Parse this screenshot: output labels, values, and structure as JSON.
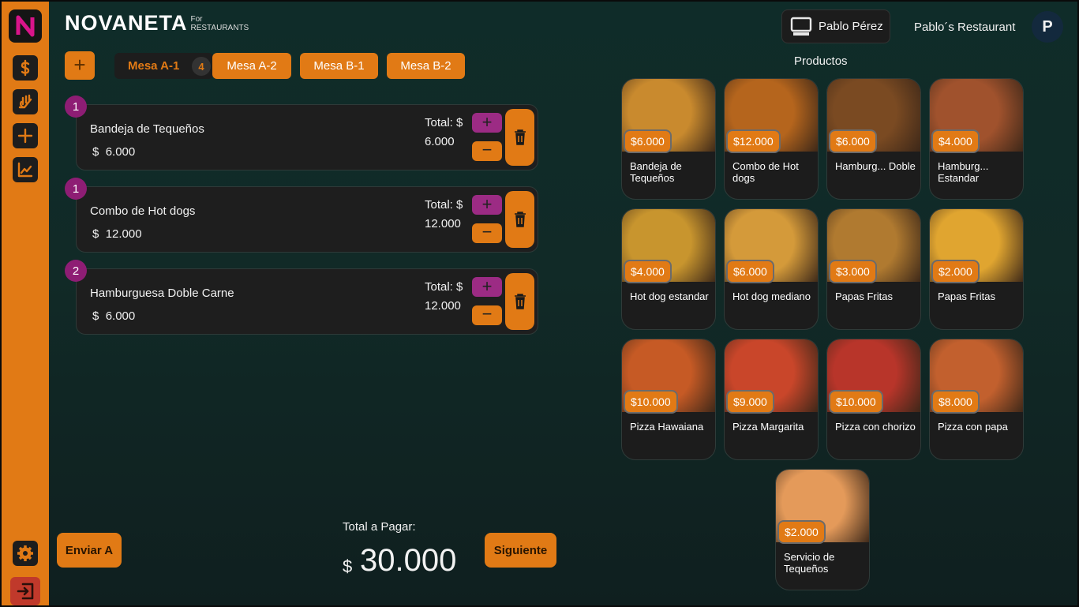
{
  "header": {
    "brand": "NOVANETA",
    "brand_for": "For",
    "brand_sub": "RESTAURANTS",
    "user_name": "Pablo Pérez",
    "restaurant": "Pablo´s Restaurant",
    "avatar_initial": "P"
  },
  "sidebar": {
    "items": [
      {
        "icon": "dollar-icon"
      },
      {
        "icon": "serving-icon"
      },
      {
        "icon": "plus-icon"
      },
      {
        "icon": "chart-icon"
      },
      {
        "icon": "gear-icon"
      },
      {
        "icon": "logout-icon"
      }
    ]
  },
  "tabs": [
    {
      "label": "Mesa A-1",
      "badge": "4",
      "active": true
    },
    {
      "label": "Mesa A-2"
    },
    {
      "label": "Mesa B-1"
    },
    {
      "label": "Mesa B-2"
    }
  ],
  "order": {
    "total_label": "Total: $",
    "currency": "$",
    "items": [
      {
        "qty": "1",
        "name": "Bandeja de Tequeños",
        "price": "6.000",
        "total": "6.000"
      },
      {
        "qty": "1",
        "name": "Combo de Hot dogs",
        "price": "12.000",
        "total": "12.000"
      },
      {
        "qty": "2",
        "name": "Hamburguesa Doble Carne",
        "price": "6.000",
        "total": "12.000"
      }
    ]
  },
  "footer": {
    "send_label": "Enviar A",
    "pay_label": "Total a Pagar:",
    "currency": "$",
    "pay_amount": "30.000",
    "next_label": "Siguiente"
  },
  "products": {
    "title": "Productos",
    "items": [
      {
        "price": "$6.000",
        "name": "Bandeja de Tequeños",
        "color": "#c98a2e"
      },
      {
        "price": "$12.000",
        "name": "Combo de Hot dogs",
        "color": "#b5651d"
      },
      {
        "price": "$6.000",
        "name": "Hamburg... Doble",
        "color": "#7a4a22"
      },
      {
        "price": "$4.000",
        "name": "Hamburg... Estandar",
        "color": "#a0522d"
      },
      {
        "price": "$4.000",
        "name": "Hot dog estandar",
        "color": "#c8952e"
      },
      {
        "price": "$6.000",
        "name": "Hot dog mediano",
        "color": "#d49a3a"
      },
      {
        "price": "$3.000",
        "name": "Papas Fritas",
        "color": "#b07a30"
      },
      {
        "price": "$2.000",
        "name": "Papas Fritas",
        "color": "#e0a530"
      },
      {
        "price": "$10.000",
        "name": "Pizza Hawaiana",
        "color": "#c65a25"
      },
      {
        "price": "$9.000",
        "name": "Pizza Margarita",
        "color": "#c9462a"
      },
      {
        "price": "$10.000",
        "name": "Pizza con chorizo",
        "color": "#b8352a"
      },
      {
        "price": "$8.000",
        "name": "Pizza con papa",
        "color": "#c2602e"
      },
      {
        "price": "$2.000",
        "name": "Servicio de Tequeños",
        "color": "#e49a5a"
      }
    ]
  }
}
